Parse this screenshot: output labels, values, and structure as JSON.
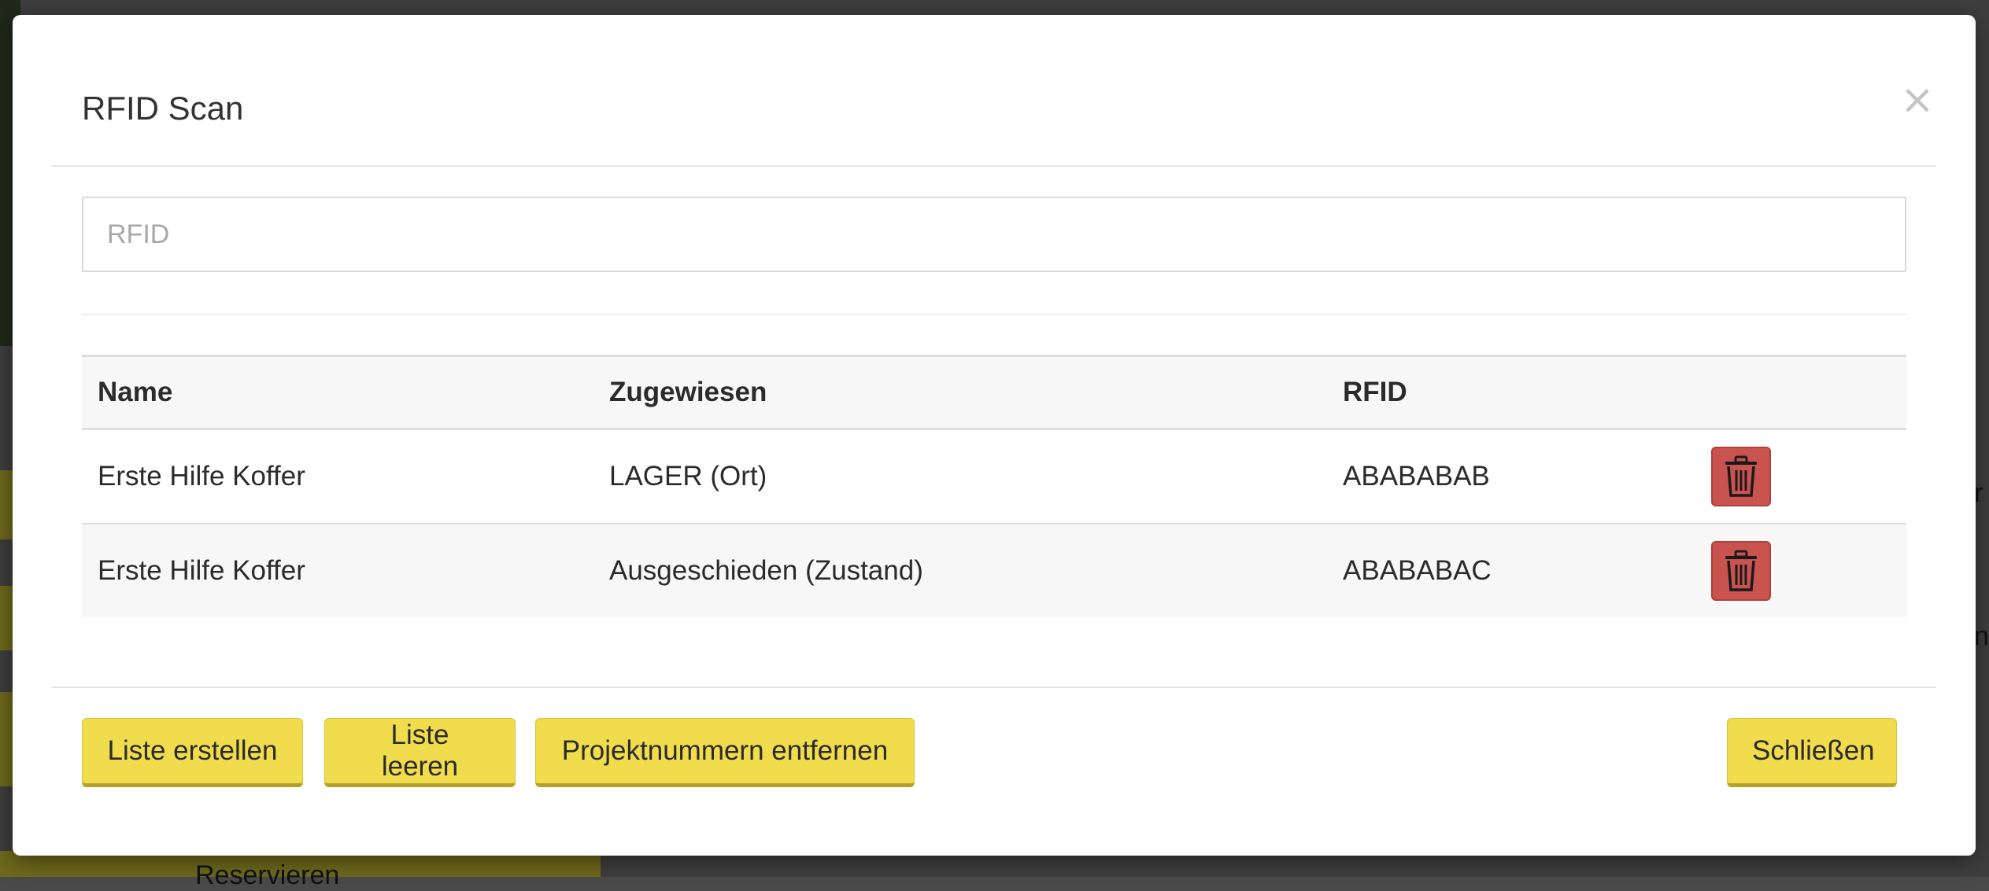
{
  "background": {
    "partial_texts": [
      "Reservieren",
      "r",
      "n"
    ]
  },
  "modal": {
    "title": "RFID Scan",
    "close_label": "×",
    "input": {
      "placeholder": "RFID",
      "value": ""
    },
    "table": {
      "headers": [
        "Name",
        "Zugewiesen",
        "RFID"
      ],
      "rows": [
        {
          "name": "Erste Hilfe Koffer",
          "zugewiesen": "LAGER (Ort)",
          "rfid": "ABABABAB",
          "action_icon": "trash-icon"
        },
        {
          "name": "Erste Hilfe Koffer",
          "zugewiesen": "Ausgeschieden (Zustand)",
          "rfid": "ABABABAC",
          "action_icon": "trash-icon"
        }
      ]
    },
    "footer": {
      "buttons": [
        "Liste erstellen",
        "Liste leeren",
        "Projektnummern entfernen"
      ],
      "close_button": "Schließen"
    }
  },
  "colors": {
    "primary_button": "#f0dc4c",
    "danger_button": "#c9534f",
    "overlay": "#4a4a4a"
  }
}
